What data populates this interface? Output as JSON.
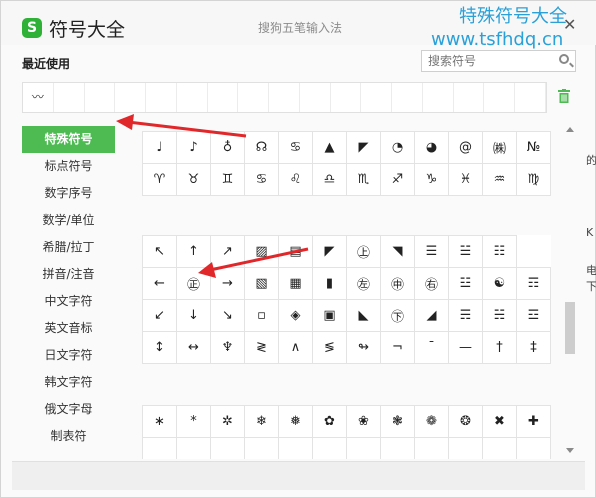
{
  "app": {
    "title": "符号大全",
    "subtitle": "搜狗五笔输入法",
    "logo_letter": "S",
    "close_symbol": "✕",
    "watermark_line1": "特殊符号大全",
    "watermark_line2": "www.tsfhdq.cn"
  },
  "recent": {
    "label": "最近使用",
    "items": [
      "〰",
      "",
      "",
      "",
      "",
      "",
      "",
      "",
      "",
      "",
      "",
      "",
      "",
      "",
      "",
      "",
      ""
    ]
  },
  "search": {
    "placeholder": "搜索符号"
  },
  "sidebar": {
    "items": [
      {
        "label": "特殊符号",
        "active": true
      },
      {
        "label": "标点符号",
        "active": false
      },
      {
        "label": "数字序号",
        "active": false
      },
      {
        "label": "数学/单位",
        "active": false
      },
      {
        "label": "希腊/拉丁",
        "active": false
      },
      {
        "label": "拼音/注音",
        "active": false
      },
      {
        "label": "中文字符",
        "active": false
      },
      {
        "label": "英文音标",
        "active": false
      },
      {
        "label": "日文字符",
        "active": false
      },
      {
        "label": "韩文字符",
        "active": false
      },
      {
        "label": "俄文字母",
        "active": false
      },
      {
        "label": "制表符",
        "active": false
      }
    ]
  },
  "grid": {
    "section1": [
      [
        "♩",
        "♪",
        "♁",
        "☊",
        "♋",
        "▲",
        "◤",
        "◔",
        "◕",
        "@",
        "㈱",
        "№"
      ],
      [
        "♈",
        "♉",
        "♊",
        "♋",
        "♌",
        "♎",
        "♏",
        "♐",
        "♑",
        "♓",
        "♒",
        "♍"
      ]
    ],
    "section2": [
      [
        "↖",
        "↑",
        "↗",
        "▨",
        "▤",
        "◤",
        "㊤",
        "◥",
        "☰",
        "☱",
        "☷"
      ],
      [
        "←",
        "㊣",
        "→",
        "▧",
        "▦",
        "▮",
        "㊧",
        "㊥",
        "㊨",
        "☳",
        "☯",
        "☶"
      ],
      [
        "↙",
        "↓",
        "↘",
        "▫",
        "◈",
        "▣",
        "◣",
        "㊦",
        "◢",
        "☴",
        "☵",
        "☲"
      ],
      [
        "↕",
        "↔",
        "♆",
        "≷",
        "∧",
        "≶",
        "↬",
        "¬",
        "¯",
        "—",
        "†",
        "‡"
      ]
    ],
    "section3": [
      [
        "∗",
        "*",
        "✲",
        "❄",
        "❅",
        "✿",
        "❀",
        "❃",
        "❁",
        "❂",
        "✖",
        "✚"
      ],
      [
        "",
        "",
        "",
        "",
        "",
        "",
        "",
        "",
        "",
        "",
        "",
        ""
      ]
    ]
  },
  "right_fragments": [
    "的",
    "K",
    "电",
    "下"
  ],
  "colors": {
    "accent": "#4dbb52",
    "watermark": "#2aa0d8",
    "arrow": "#e0282a"
  }
}
